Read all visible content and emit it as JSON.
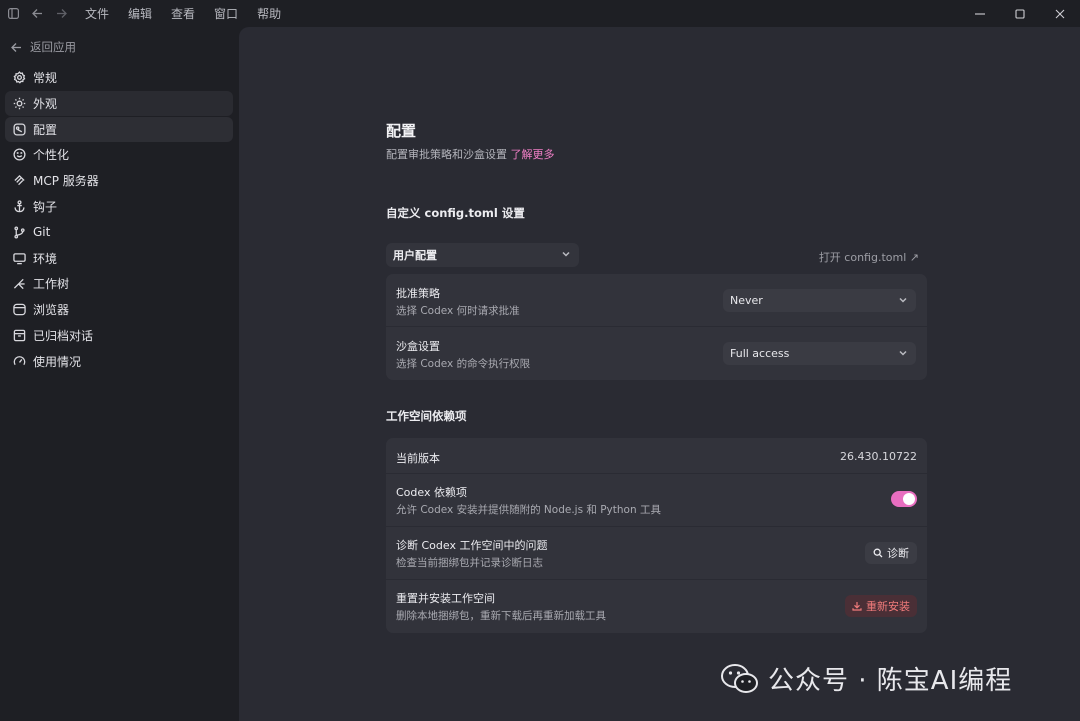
{
  "titlebar": {
    "menu": [
      "文件",
      "编辑",
      "查看",
      "窗口",
      "帮助"
    ]
  },
  "sidebar": {
    "back_label": "返回应用",
    "items": [
      {
        "label": "常规",
        "icon": "gear-icon"
      },
      {
        "label": "外观",
        "icon": "sun-icon"
      },
      {
        "label": "配置",
        "icon": "sliders-icon"
      },
      {
        "label": "个性化",
        "icon": "smile-icon"
      },
      {
        "label": "MCP 服务器",
        "icon": "mcp-icon"
      },
      {
        "label": "钩子",
        "icon": "anchor-icon"
      },
      {
        "label": "Git",
        "icon": "git-branch-icon"
      },
      {
        "label": "环境",
        "icon": "monitor-icon"
      },
      {
        "label": "工作树",
        "icon": "worktree-icon"
      },
      {
        "label": "浏览器",
        "icon": "browser-icon"
      },
      {
        "label": "已归档对话",
        "icon": "archive-icon"
      },
      {
        "label": "使用情况",
        "icon": "gauge-icon"
      }
    ]
  },
  "main": {
    "title": "配置",
    "subtitle": "配置审批策略和沙盒设置",
    "learn_more": "了解更多",
    "custom_section_title": "自定义 config.toml 设置",
    "profile_select": "用户配置",
    "open_config": "打开 config.toml ↗",
    "policy_rows": [
      {
        "label": "批准策略",
        "desc": "选择 Codex 何时请求批准",
        "value": "Never"
      },
      {
        "label": "沙盒设置",
        "desc": "选择 Codex 的命令执行权限",
        "value": "Full access"
      }
    ],
    "workspace_section_title": "工作空间依赖项",
    "version_label": "当前版本",
    "version_value": "26.430.10722",
    "deps_label": "Codex 依赖项",
    "deps_desc": "允许 Codex 安装并提供随附的 Node.js 和 Python 工具",
    "deps_enabled": true,
    "diag_label": "诊断 Codex 工作空间中的问题",
    "diag_desc": "检查当前捆绑包并记录诊断日志",
    "diag_button": "诊断",
    "reset_label": "重置并安装工作空间",
    "reset_desc": "删除本地捆绑包，重新下载后再重新加载工具",
    "reinstall_button": "重新安装"
  },
  "watermark": {
    "text": "公众号 · 陈宝AI编程"
  },
  "colors": {
    "accent": "#f07fc6",
    "toggle": "#e86ec0",
    "danger": "#f07b7b"
  }
}
